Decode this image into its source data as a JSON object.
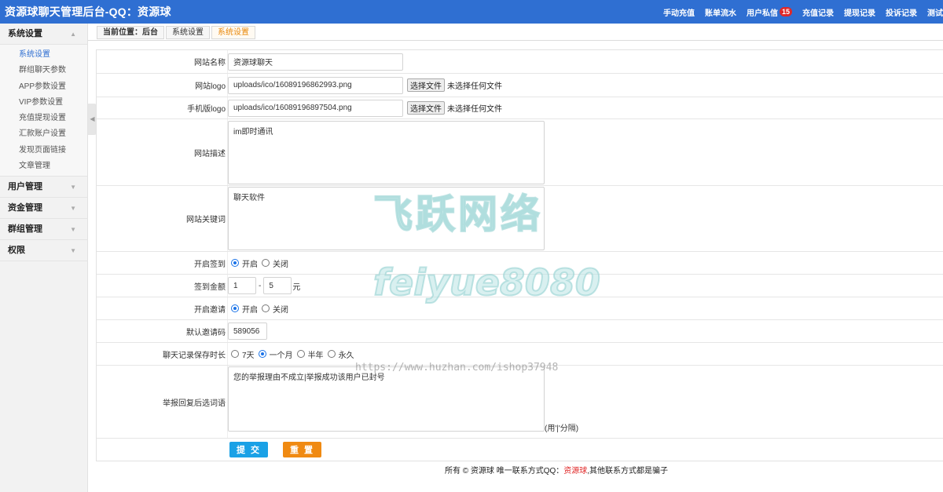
{
  "header": {
    "title": "资源球聊天管理后台-QQ：资源球",
    "nav": [
      {
        "label": "手动充值"
      },
      {
        "label": "账单流水"
      },
      {
        "label": "用户私信",
        "badge": "15"
      },
      {
        "label": "充值记录"
      },
      {
        "label": "提现记录"
      },
      {
        "label": "投诉记录"
      },
      {
        "label": "测试"
      }
    ]
  },
  "sidebar": {
    "groups": [
      {
        "label": "系统设置",
        "items": [
          "系统设置",
          "群组聊天参数",
          "APP参数设置",
          "VIP参数设置",
          "充值提现设置",
          "汇款账户设置",
          "发现页面链接",
          "文章管理"
        ]
      },
      {
        "label": "用户管理"
      },
      {
        "label": "资金管理"
      },
      {
        "label": "群组管理"
      },
      {
        "label": "权限"
      }
    ]
  },
  "breadcrumb": [
    "当前位置：后台",
    "系统设置",
    "系统设置"
  ],
  "form": {
    "site_name": {
      "label": "网站名称",
      "value": "资源球聊天"
    },
    "site_logo": {
      "label": "网站logo",
      "value": "uploads/ico/16089196862993.png",
      "button": "选择文件",
      "note": "未选择任何文件"
    },
    "mobile_logo": {
      "label": "手机版logo",
      "value": "uploads/ico/16089196897504.png",
      "button": "选择文件",
      "note": "未选择任何文件"
    },
    "description": {
      "label": "网站描述",
      "value": "im即时通讯"
    },
    "keywords": {
      "label": "网站关键词",
      "value": "聊天软件"
    },
    "sign_in": {
      "label": "开启签到",
      "options": [
        "开启",
        "关闭"
      ],
      "selected": "开启"
    },
    "sign_amount": {
      "label": "签到金额",
      "min": "1",
      "sep": "-",
      "max": "5",
      "unit": "元"
    },
    "invite": {
      "label": "开启邀请",
      "options": [
        "开启",
        "关闭"
      ],
      "selected": "开启"
    },
    "invite_code": {
      "label": "默认邀请码",
      "value": "589056"
    },
    "retention": {
      "label": "聊天记录保存时长",
      "options": [
        "7天",
        "一个月",
        "半年",
        "永久"
      ],
      "selected": "一个月"
    },
    "report_reply": {
      "label": "举报回复后选词语",
      "value": "您的举报理由不成立|举报成功该用户已封号",
      "hint": "(用'|'分隔)"
    },
    "submit": "提 交",
    "reset": "重 置"
  },
  "footer": {
    "prefix": "所有 © 资源球 唯一联系方式QQ：",
    "qq": "资源球",
    "suffix": ",其他联系方式都是骗子"
  },
  "watermarks": {
    "brand": "飞跃网络",
    "handle": "feiyue8080",
    "url": "https://www.huzhan.com/ishop37948"
  },
  "colors": {
    "header": "#2f6fd2",
    "submit": "#1aa1e6",
    "reset": "#f08a12",
    "breadcrumb_active": "#e8890c",
    "badge": "#e02828"
  }
}
